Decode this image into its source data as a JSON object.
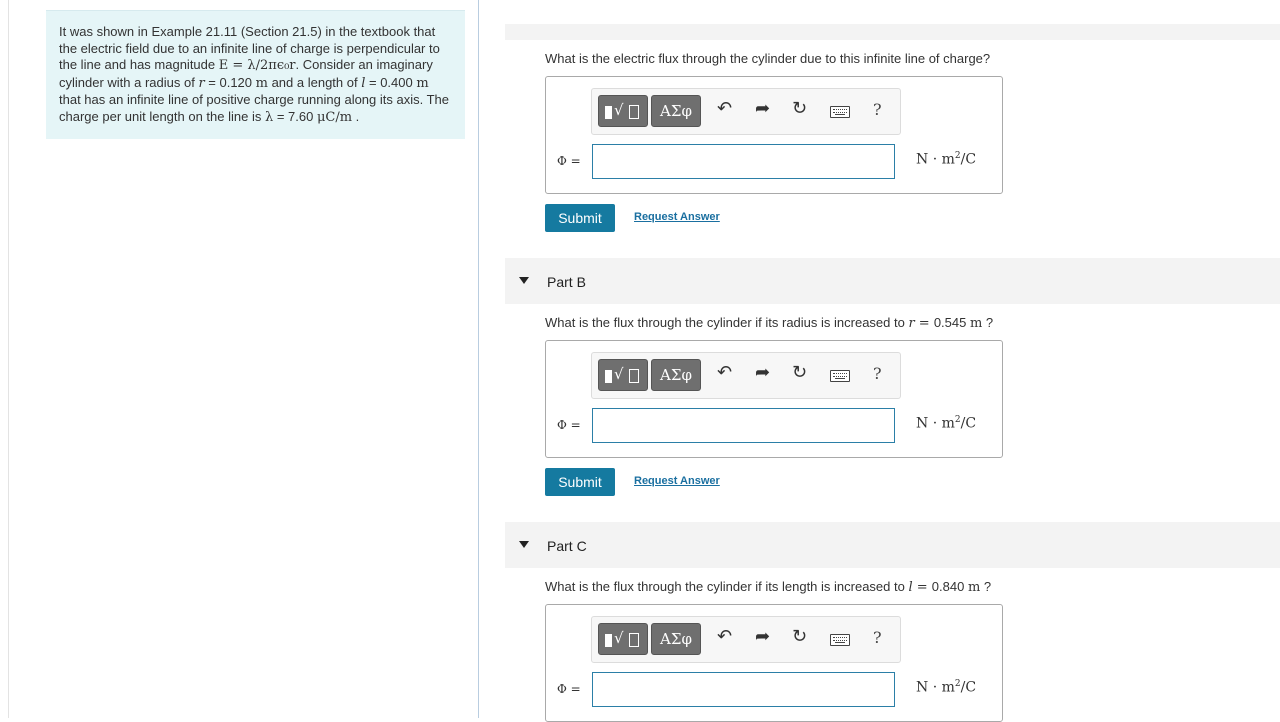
{
  "intro": {
    "p1": "It was shown in Example 21.11 (Section 21.5) in the textbook that the electric field due to an infinite line of charge is perpendicular to the line and has magnitude ",
    "eq": "E = λ/2πϵ₀r",
    "p2": ". Consider an imaginary cylinder with a radius of ",
    "r_sym": "r",
    "r_val": " = 0.120 ",
    "r_unit": "m",
    "p3": " and a length of ",
    "l_sym": "l",
    "l_val": " = 0.400 ",
    "l_unit": "m",
    "p4": " that has an infinite line of positive charge running along its axis. The charge per unit length on the line is ",
    "lam_sym": "λ",
    "lam_val": " = 7.60 ",
    "lam_unit": "μC/m",
    "p5": " ."
  },
  "toolbar": {
    "greek_label": "ΑΣφ",
    "undo_icon": "↶",
    "redo_icon": "➦",
    "reset_icon": "↻",
    "help_label": "?"
  },
  "parts": [
    {
      "header": "",
      "q_pre": "What is the electric flux through the cylinder due to this infinite line of charge?",
      "q_sym": "",
      "q_val": "",
      "q_post": "",
      "phi_label": "Φ =",
      "unit": "N · m",
      "unit_sup": "2",
      "unit_post": "/C",
      "submit": "Submit",
      "request": "Request Answer"
    },
    {
      "header": "Part B",
      "q_pre": "What is the flux through the cylinder if its radius is increased to ",
      "q_sym": "r = ",
      "q_val": "0.545 ",
      "q_unit": "m",
      "q_post": " ?",
      "phi_label": "Φ =",
      "unit": "N · m",
      "unit_sup": "2",
      "unit_post": "/C",
      "submit": "Submit",
      "request": "Request Answer"
    },
    {
      "header": "Part C",
      "q_pre": "What is the flux through the cylinder if its length is increased to ",
      "q_sym": "l = ",
      "q_val": "0.840 ",
      "q_unit": "m",
      "q_post": " ?",
      "phi_label": "Φ =",
      "unit": "N · m",
      "unit_sup": "2",
      "unit_post": "/C"
    }
  ]
}
